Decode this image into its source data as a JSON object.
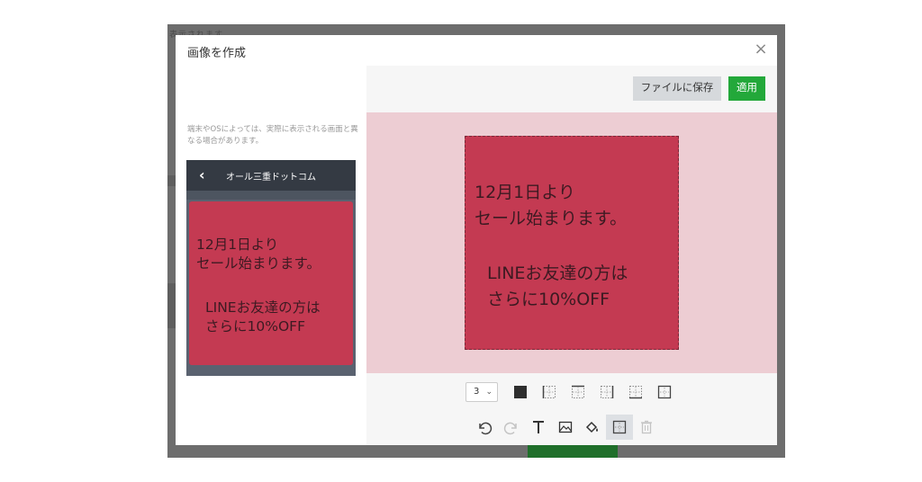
{
  "backdrop": {
    "peek_text": "表示されます"
  },
  "modal": {
    "title": "画像を作成"
  },
  "preview": {
    "notice": "端末やOSによっては、実際に表示される画面と異なる場合があります。",
    "header_title": "オール三重ドットコム",
    "message_line1": "12月1日より",
    "message_line2": "セール始まります。",
    "message_line3": "LINEお友達の方は",
    "message_line4": "さらに10%OFF"
  },
  "toolbar": {
    "save_label": "ファイルに保存",
    "apply_label": "適用"
  },
  "canvas": {
    "line1": "12月1日より",
    "line2": "セール始まります。",
    "line3": "LINEお友達の方は",
    "line4": "さらに10%OFF",
    "background_color": "#c43a52",
    "text_color": "#3c1a22"
  },
  "tools": {
    "border_width": "3",
    "row1": [
      "color-swatch-icon",
      "border-left-icon",
      "border-top-icon",
      "border-right-icon",
      "border-bottom-icon",
      "border-all-icon"
    ],
    "row2": [
      "undo-icon",
      "redo-icon",
      "text-icon",
      "image-icon",
      "fill-icon",
      "border-icon",
      "trash-icon"
    ],
    "active_tool": "border-icon"
  },
  "colors": {
    "accent": "#23a83a",
    "canvas_bg": "#edcdd3"
  }
}
